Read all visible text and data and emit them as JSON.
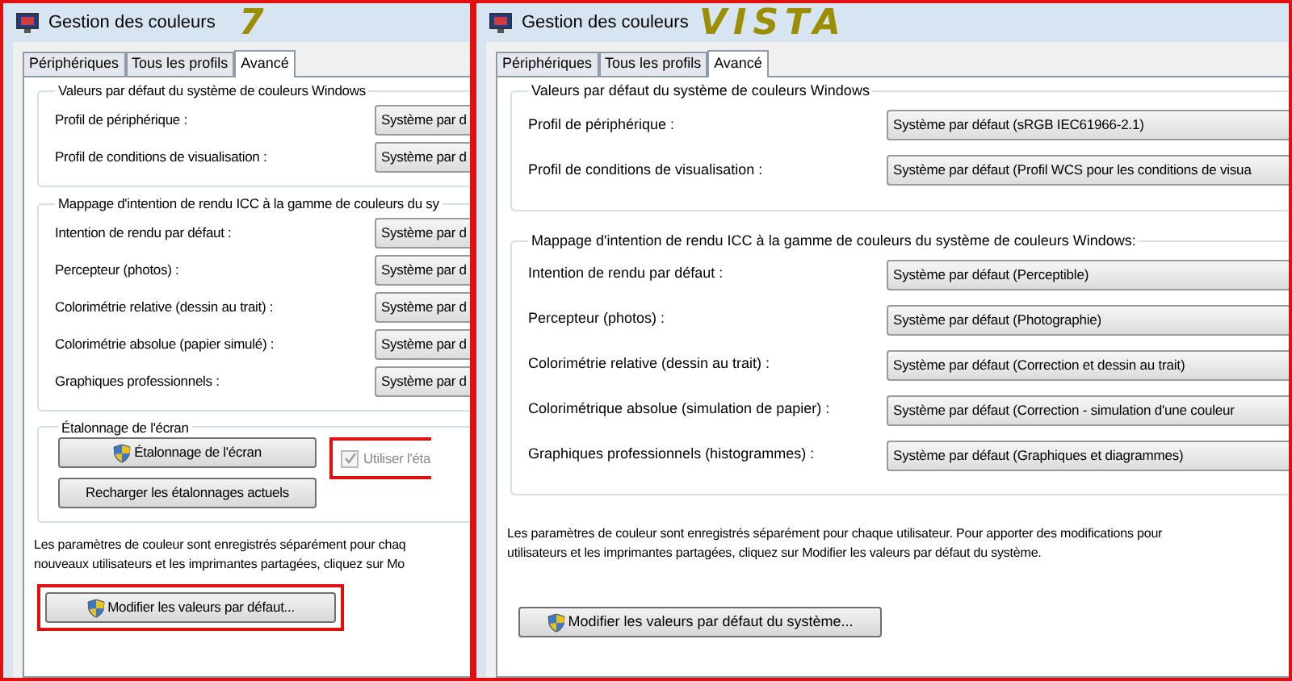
{
  "windows": [
    {
      "title": "Gestion des couleurs",
      "annotation": "7",
      "highlighted": true,
      "tabs": [
        {
          "label": "Périphériques",
          "selected": false
        },
        {
          "label": "Tous les profils",
          "selected": false
        },
        {
          "label": "Avancé",
          "selected": true
        }
      ],
      "groups": [
        {
          "title": "Valeurs par défaut du système de couleurs Windows",
          "rows": [
            {
              "label": "Profil de périphérique :",
              "value": "Système par d"
            },
            {
              "label": "Profil de conditions de visualisation :",
              "value": "Système par d"
            }
          ]
        },
        {
          "title": "Mappage d'intention de rendu ICC à la gamme de couleurs du sy",
          "rows": [
            {
              "label": "Intention de rendu par défaut :",
              "value": "Système par d"
            },
            {
              "label": "Percepteur (photos) :",
              "value": "Système par d"
            },
            {
              "label": "Colorimétrie relative (dessin au trait) :",
              "value": "Système par d"
            },
            {
              "label": "Colorimétrie absolue (papier simulé) :",
              "value": "Système par d"
            },
            {
              "label": "Graphiques professionnels :",
              "value": "Système par d"
            }
          ]
        }
      ],
      "calibration": {
        "title": "Étalonnage de l'écran",
        "buttons": [
          {
            "label": "Étalonnage de l'écran",
            "shield": true
          },
          {
            "label": "Recharger les étalonnages actuels",
            "shield": false
          }
        ],
        "checkbox": {
          "label": "Utiliser l'éta",
          "checked": true,
          "disabled": true,
          "highlighted": true
        }
      },
      "note_lines": [
        "Les paramètres de couleur sont enregistrés séparément pour chaq",
        "nouveaux utilisateurs et les imprimantes partagées, cliquez sur Mo"
      ],
      "button": {
        "label": "Modifier les valeurs par défaut...",
        "shield": true,
        "highlighted": true
      }
    },
    {
      "title": "Gestion des couleurs",
      "annotation": "VISTA",
      "highlighted": true,
      "tabs": [
        {
          "label": "Périphériques",
          "selected": false
        },
        {
          "label": "Tous les profils",
          "selected": false
        },
        {
          "label": "Avancé",
          "selected": true
        }
      ],
      "groups": [
        {
          "title": "Valeurs par défaut du système de couleurs Windows",
          "rows": [
            {
              "label": "Profil de périphérique :",
              "value": "Système par défaut (sRGB IEC61966-2.1)"
            },
            {
              "label": "Profil de conditions de visualisation :",
              "value": "Système par défaut (Profil WCS pour les conditions de visua"
            }
          ]
        },
        {
          "title": "Mappage d'intention de rendu ICC à la gamme de couleurs du système de couleurs Windows:",
          "rows": [
            {
              "label": "Intention de rendu par défaut :",
              "value": "Système par défaut (Perceptible)"
            },
            {
              "label": "Percepteur (photos) :",
              "value": "Système par défaut (Photographie)"
            },
            {
              "label": "Colorimétrie relative (dessin au trait) :",
              "value": "Système par défaut (Correction et dessin au trait)"
            },
            {
              "label": "Colorimétrique absolue (simulation de papier) :",
              "value": "Système par défaut (Correction - simulation d'une couleur"
            },
            {
              "label": "Graphiques professionnels (histogrammes) :",
              "value": "Système par défaut (Graphiques et diagrammes)"
            }
          ]
        }
      ],
      "note_lines": [
        "Les paramètres de couleur sont enregistrés séparément pour chaque utilisateur. Pour apporter des modifications pour",
        "utilisateurs et les imprimantes partagées, cliquez sur Modifier les valeurs par défaut du système."
      ],
      "button": {
        "label": "Modifier les valeurs par défaut du système...",
        "shield": true,
        "highlighted": false
      }
    }
  ]
}
